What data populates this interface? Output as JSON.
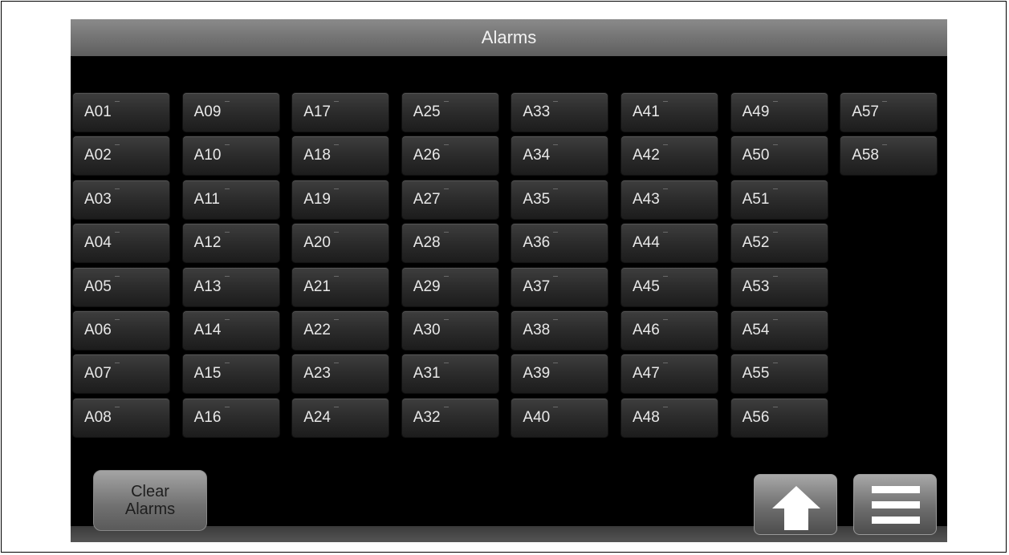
{
  "header": {
    "title": "Alarms"
  },
  "alarms": [
    [
      "A01",
      "A02",
      "A03",
      "A04",
      "A05",
      "A06",
      "A07",
      "A08"
    ],
    [
      "A09",
      "A10",
      "A11",
      "A12",
      "A13",
      "A14",
      "A15",
      "A16"
    ],
    [
      "A17",
      "A18",
      "A19",
      "A20",
      "A21",
      "A22",
      "A23",
      "A24"
    ],
    [
      "A25",
      "A26",
      "A27",
      "A28",
      "A29",
      "A30",
      "A31",
      "A32"
    ],
    [
      "A33",
      "A34",
      "A35",
      "A36",
      "A37",
      "A38",
      "A39",
      "A40"
    ],
    [
      "A41",
      "A42",
      "A43",
      "A44",
      "A45",
      "A46",
      "A47",
      "A48"
    ],
    [
      "A49",
      "A50",
      "A51",
      "A52",
      "A53",
      "A54",
      "A55",
      "A56"
    ],
    [
      "A57",
      "A58"
    ]
  ],
  "footer": {
    "clear_line1": "Clear",
    "clear_line2": "Alarms",
    "home_icon": "home-up-arrow-icon",
    "menu_icon": "menu-icon"
  },
  "colors": {
    "screen_bg": "#000000",
    "titlebar": "#6f6f6f",
    "alarm_button": "#2d2d2d",
    "alarm_text": "#e8e8e8"
  }
}
